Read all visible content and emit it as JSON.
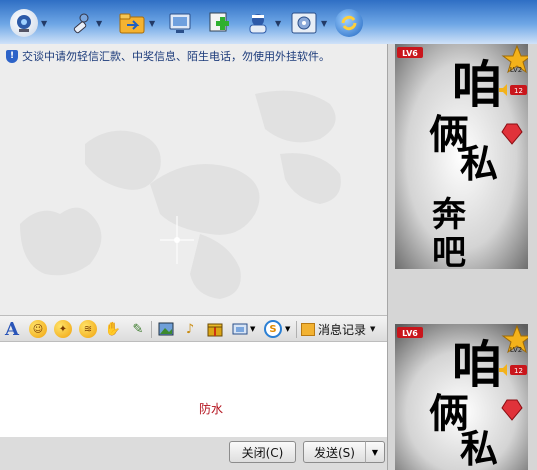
{
  "toolbar": {
    "icons": [
      "webcam-icon",
      "microphone-icon",
      "folder-icon",
      "remote-assist-icon",
      "add-app-icon",
      "user-info-icon",
      "settings-icon",
      "refresh-icon"
    ]
  },
  "chat": {
    "notice": "交谈中请勿轻信汇款、中奖信息、陌生电话，勿使用外挂软件。"
  },
  "format_toolbar": {
    "font_label": "A",
    "history_label": "消息记录"
  },
  "input": {
    "text": "防水"
  },
  "buttons": {
    "close_label": "关闭(C)",
    "send_label": "发送(S)"
  },
  "avatar_top": {
    "badge": "LV6",
    "level_tag": "LV2",
    "count": "12",
    "chars": [
      "咱",
      "俩",
      "私",
      "奔",
      "吧"
    ]
  },
  "avatar_bottom": {
    "badge": "LV6",
    "level_tag": "LV2",
    "count": "12",
    "chars": [
      "咱",
      "俩",
      "私"
    ]
  },
  "colors": {
    "toolbar_top": "#2f6fc4",
    "notice_text": "#1b3a7a",
    "input_text": "#b3121d",
    "badge_red": "#c9161c",
    "star_gold": "#f3b21a"
  }
}
